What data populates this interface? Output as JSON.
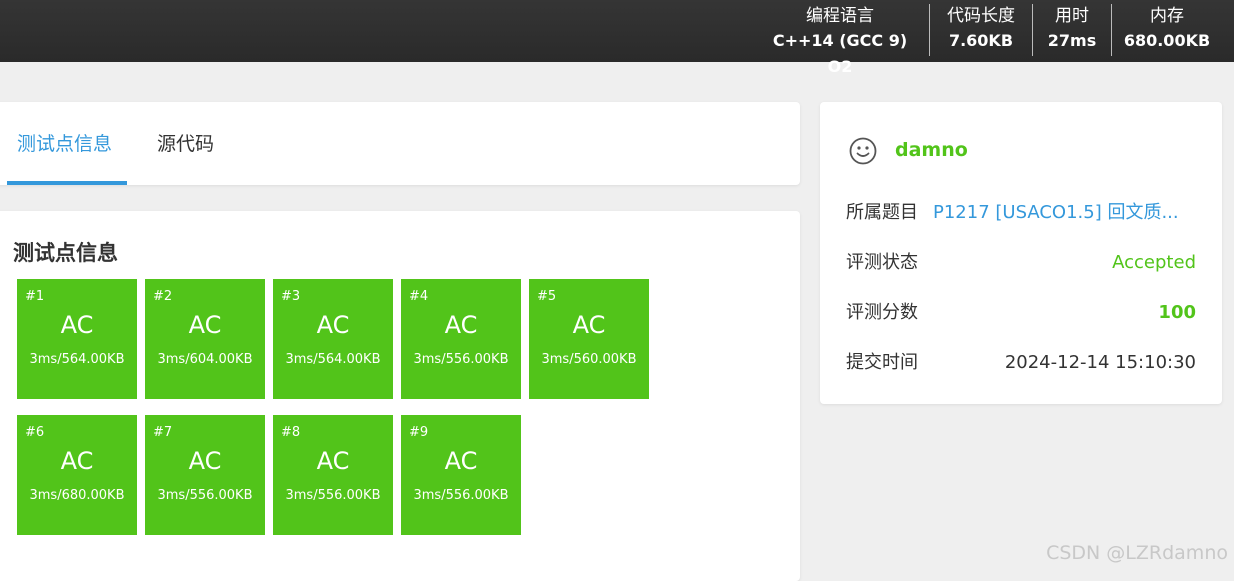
{
  "topbar": {
    "stats": [
      {
        "label": "编程语言",
        "value": "C++14 (GCC 9) O2"
      },
      {
        "label": "代码长度",
        "value": "7.60KB"
      },
      {
        "label": "用时",
        "value": "27ms"
      },
      {
        "label": "内存",
        "value": "680.00KB"
      }
    ]
  },
  "tabs": [
    {
      "label": "测试点信息",
      "active": true
    },
    {
      "label": "源代码",
      "active": false
    }
  ],
  "section_title": "测试点信息",
  "testcases": [
    {
      "id": "#1",
      "status": "AC",
      "resource": "3ms/564.00KB"
    },
    {
      "id": "#2",
      "status": "AC",
      "resource": "3ms/604.00KB"
    },
    {
      "id": "#3",
      "status": "AC",
      "resource": "3ms/564.00KB"
    },
    {
      "id": "#4",
      "status": "AC",
      "resource": "3ms/556.00KB"
    },
    {
      "id": "#5",
      "status": "AC",
      "resource": "3ms/560.00KB"
    },
    {
      "id": "#6",
      "status": "AC",
      "resource": "3ms/680.00KB"
    },
    {
      "id": "#7",
      "status": "AC",
      "resource": "3ms/556.00KB"
    },
    {
      "id": "#8",
      "status": "AC",
      "resource": "3ms/556.00KB"
    },
    {
      "id": "#9",
      "status": "AC",
      "resource": "3ms/556.00KB"
    }
  ],
  "info": {
    "avatar_icon": "smiley-face-icon",
    "username": "damno",
    "problem_label": "所属题目",
    "problem_value": "P1217 [USACO1.5] 回文质...",
    "status_label": "评测状态",
    "status_value": "Accepted",
    "score_label": "评测分数",
    "score_value": "100",
    "time_label": "提交时间",
    "time_value": "2024-12-14 15:10:30"
  },
  "colors": {
    "accent": "#3498db",
    "ac_green": "#52c41a",
    "topbar": "#2f2f2f"
  },
  "watermark": "CSDN @LZRdamno"
}
